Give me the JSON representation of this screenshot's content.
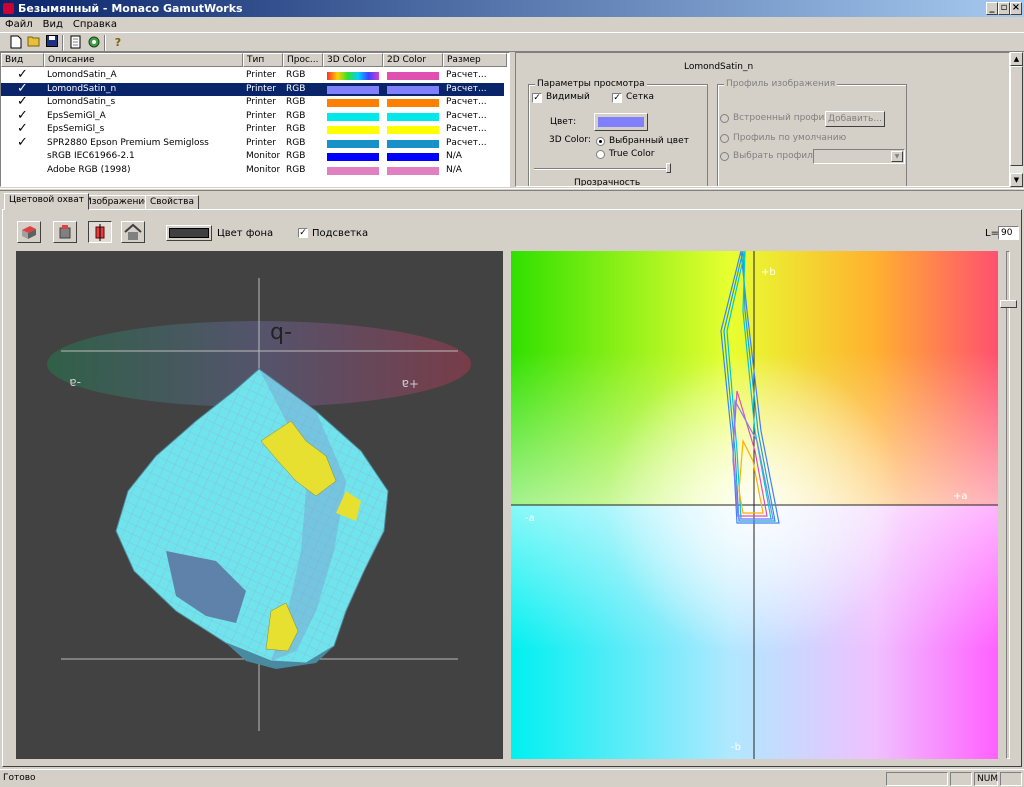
{
  "window": {
    "title": "Безымянный - Monaco GamutWorks",
    "min": "_",
    "max": "▫",
    "close": "×"
  },
  "menu": [
    "Файл",
    "Вид",
    "Справка"
  ],
  "list": {
    "headers": [
      "Вид",
      "Описание",
      "Тип",
      "Прос...",
      "3D Color",
      "2D Color",
      "Размер"
    ],
    "rows": [
      {
        "checked": true,
        "name": "LomondSatin_A",
        "type": "Printer",
        "space": "RGB",
        "c3d": "rainbow",
        "c2d": "#e050b0",
        "size": "Расчет...",
        "selected": false
      },
      {
        "checked": true,
        "name": "LomondSatin_n",
        "type": "Printer",
        "space": "RGB",
        "c3d": "#8080ff",
        "c2d": "#8080ff",
        "size": "Расчет...",
        "selected": true
      },
      {
        "checked": true,
        "name": "LomondSatin_s",
        "type": "Printer",
        "space": "RGB",
        "c3d": "#ff8000",
        "c2d": "#ff8000",
        "size": "Расчет...",
        "selected": false
      },
      {
        "checked": true,
        "name": "EpsSemiGl_A",
        "type": "Printer",
        "space": "RGB",
        "c3d": "#00e8e8",
        "c2d": "#00e8e8",
        "size": "Расчет...",
        "selected": false
      },
      {
        "checked": true,
        "name": "EpsSemiGl_s",
        "type": "Printer",
        "space": "RGB",
        "c3d": "#ffff00",
        "c2d": "#ffff00",
        "size": "Расчет...",
        "selected": false
      },
      {
        "checked": true,
        "name": "SPR2880 Epson Premium Semigloss",
        "type": "Printer",
        "space": "RGB",
        "c3d": "#1890c8",
        "c2d": "#1890c8",
        "size": "Расчет...",
        "selected": false
      },
      {
        "checked": false,
        "name": "sRGB IEC61966-2.1",
        "type": "Monitor",
        "space": "RGB",
        "c3d": "#0000ff",
        "c2d": "#0000ff",
        "size": "N/A",
        "selected": false
      },
      {
        "checked": false,
        "name": "Adobe RGB (1998)",
        "type": "Monitor",
        "space": "RGB",
        "c3d": "#e080c0",
        "c2d": "#e080c0",
        "size": "N/A",
        "selected": false
      }
    ]
  },
  "props": {
    "title": "LomondSatin_n",
    "view_group": "Параметры просмотра",
    "visible_label": "Видимый",
    "grid_label": "Сетка",
    "color_label": "Цвет:",
    "color_value": "#8080ff",
    "color3d_label": "3D Color:",
    "opt_selected": "Выбранный цвет",
    "opt_true": "True Color",
    "transparency_label": "Прозрачность",
    "profile_group": "Профиль изображения",
    "embedded_label": "Встроенный профиль",
    "add_button": "Добавить...",
    "default_label": "Профиль по умолчанию",
    "choose_label": "Выбрать профиль"
  },
  "tabs": [
    "Цветовой охват",
    "Изображение",
    "Свойства"
  ],
  "gamut": {
    "bg_label": "Цвет фона",
    "bg_color": "#404040",
    "highlight_label": "Подсветка",
    "l_label": "L=",
    "l_value": "90"
  },
  "view3d": {
    "minus_b": "-b",
    "minus_a": "-a",
    "plus_a": "+a"
  },
  "view2d": {
    "plus_b": "+b",
    "minus_b": "-b",
    "minus_a": "-a",
    "plus_a": "+a"
  },
  "status": {
    "text": "Готово",
    "num": "NUM"
  }
}
